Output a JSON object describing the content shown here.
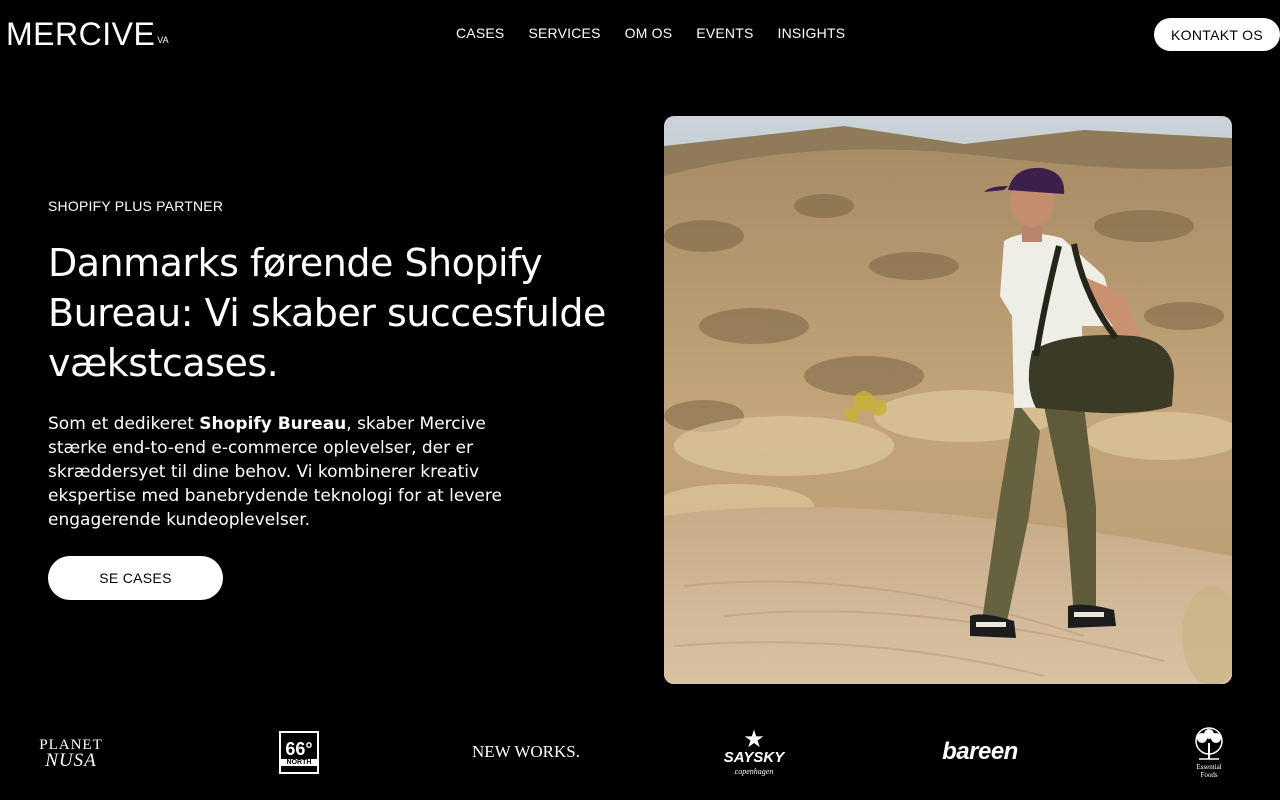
{
  "header": {
    "logo": "MERCIVE",
    "logo_mark": "VA",
    "nav": [
      "CASES",
      "SERVICES",
      "OM OS",
      "EVENTS",
      "INSIGHTS"
    ],
    "contact_label": "KONTAKT OS"
  },
  "hero": {
    "eyebrow": "SHOPIFY PLUS PARTNER",
    "headline": "Danmarks førende Shopify Bureau: Vi skaber succesfulde vækstcases.",
    "body_prefix": "Som et dedikeret ",
    "body_bold": "Shopify Bureau",
    "body_suffix": ", skaber Mercive stærke end-to-end e-commerce oplevelser, der er skræddersyet til dine behov. Vi kombinerer kreativ ekspertise med banebrydende teknologi for at levere engagerende kundeoplevelser.",
    "cta_label": "SE CASES"
  },
  "brands": {
    "planet_nusa_top": "PLANET",
    "planet_nusa_bottom": "NUSA",
    "north_number": "66°",
    "north_label": "NORTH",
    "new_works": "NEW WORKS.",
    "saysky": "SAYSKY",
    "saysky_sub": "copenhagen",
    "bareen": "bareen",
    "essential_foods_top": "Essential",
    "essential_foods_bottom": "Foods"
  }
}
